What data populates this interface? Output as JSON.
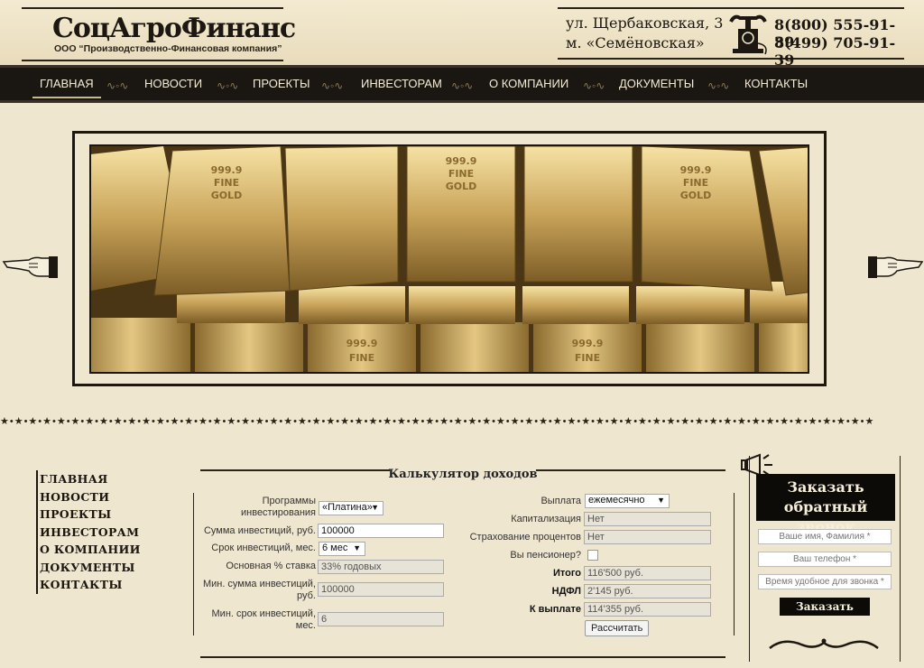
{
  "header": {
    "logo_title": "СоцАгроФинанс",
    "logo_subtitle": "ООО “Производственно-Финансовая компания”",
    "address_line1": "ул. Щербаковская, 3",
    "address_line2": "м. «Семёновская»",
    "phone1": "8(800) 555-91-39",
    "phone2": "8(499) 705-91-39"
  },
  "nav": {
    "items": [
      "ГЛАВНАЯ",
      "НОВОСТИ",
      "ПРОЕКТЫ",
      "ИНВЕСТОРАМ",
      "О КОМПАНИИ",
      "ДОКУМЕНТЫ",
      "КОНТАКТЫ"
    ],
    "active": "ГЛАВНАЯ"
  },
  "sidebar": {
    "items": [
      "ГЛАВНАЯ",
      "НОВОСТИ",
      "ПРОЕКТЫ",
      "ИНВЕСТОРАМ",
      "О КОМПАНИИ",
      "ДОКУМЕНТЫ",
      "КОНТАКТЫ"
    ]
  },
  "slider": {
    "bar_text_top": "999.9",
    "bar_text_mid": "FINE",
    "bar_text_bottom": "GOLD"
  },
  "calculator": {
    "title": "Калькулятор доходов",
    "program_label": "Программы инвестирования",
    "program_value": "«Платина»",
    "sum_label": "Сумма инвестиций, руб.",
    "sum_value": "100000",
    "term_label": "Срок инвестиций, мес.",
    "term_value": "6 мес",
    "rate_label": "Основная % ставка",
    "rate_value": "33% годовых",
    "min_sum_label": "Мин. сумма инвестиций, руб.",
    "min_sum_value": "100000",
    "min_term_label": "Мин. срок инвестиций, мес.",
    "min_term_value": "6",
    "payout_label": "Выплата",
    "payout_value": "ежемесячно",
    "capitalization_label": "Капитализация",
    "capitalization_value": "Нет",
    "insurance_label": "Страхование процентов",
    "insurance_value": "Нет",
    "pensioner_label": "Вы пенсионер?",
    "total_label": "Итого",
    "total_value": "116'500 руб.",
    "ndfl_label": "НДФЛ",
    "ndfl_value": "2'145 руб.",
    "payable_label": "К выплате",
    "payable_value": "114'355 руб.",
    "calculate_button": "Рассчитать"
  },
  "callback": {
    "title_line1": "Заказать",
    "title_line2": "обратный звонок",
    "name_placeholder": "Ваше имя, Фамилия *",
    "phone_placeholder": "Ваш телефон *",
    "time_placeholder": "Время удобное для звонка *",
    "order_button": "Заказать"
  }
}
